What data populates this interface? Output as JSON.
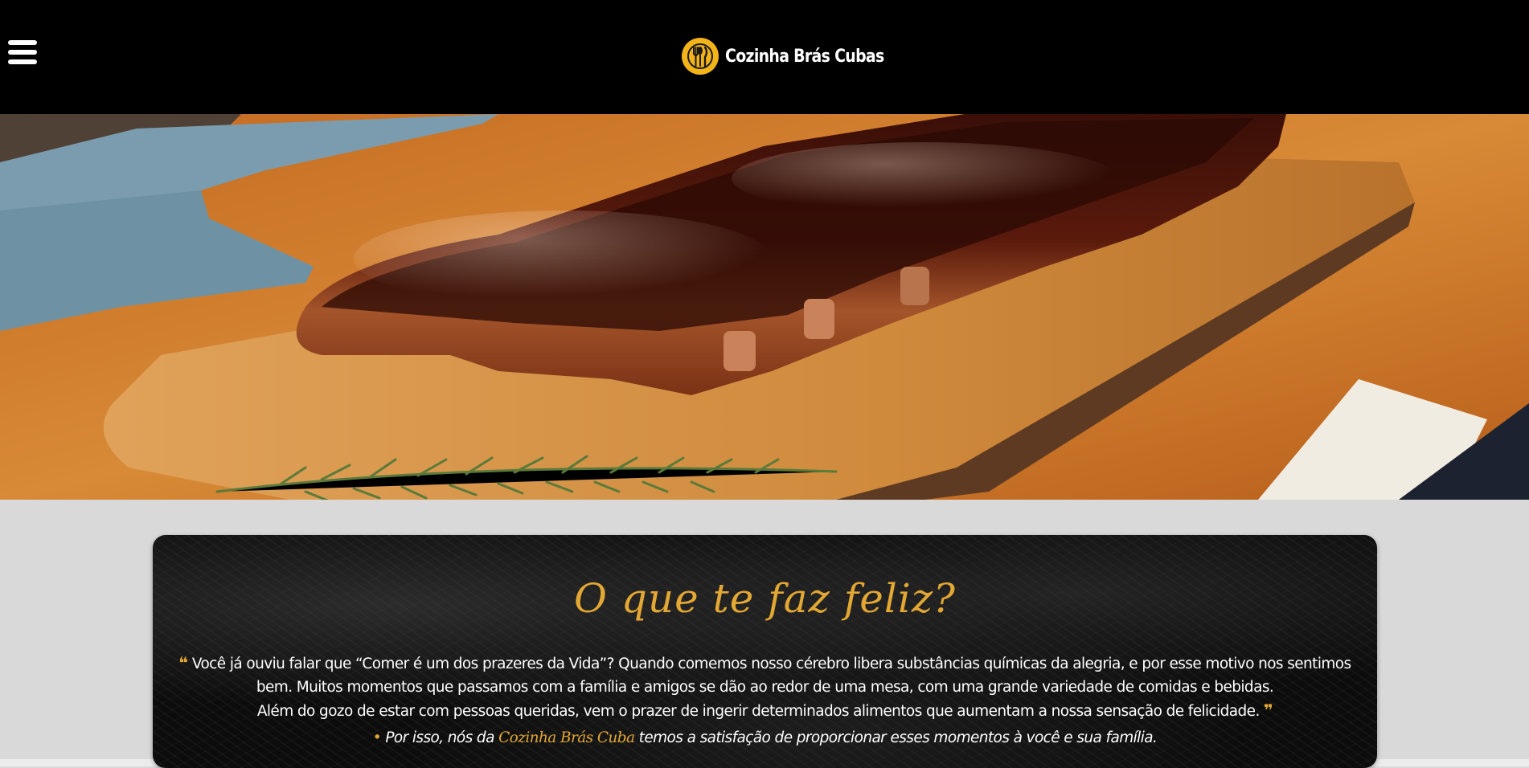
{
  "header": {
    "menu_icon": "hamburger-menu-icon",
    "logo_icon": "cutlery-logo-icon",
    "brand_name": "Cozinha Brás Cubas",
    "background": "#000000"
  },
  "hero": {
    "image": "barbecue-ribs-on-wooden-board"
  },
  "card": {
    "title": "O que te faz feliz?",
    "quote_open": "❝",
    "paragraph_1": "Você já ouviu falar que “Comer é um dos prazeres da Vida”? Quando comemos nosso cérebro libera substâncias químicas da alegria, e por esse motivo nos sentimos bem. Muitos momentos que passamos com a família e amigos se dão ao redor de uma mesa, com uma grande variedade de comidas e bebidas.",
    "paragraph_2": "Além do gozo de estar com pessoas queridas, vem o prazer de ingerir determinados alimentos que aumentam a nossa sensação de felicidade.",
    "quote_close": "❞",
    "tagline_dot": "•",
    "tagline_before": "Por isso, nós da",
    "tagline_brand": "Cozinha Brás Cuba",
    "tagline_after": "temos a satisfação de proporcionar esses momentos à você e sua família."
  },
  "colors": {
    "accent": "#e3a733",
    "logo": "#f2b418",
    "page_background": "#d9d9d9"
  }
}
